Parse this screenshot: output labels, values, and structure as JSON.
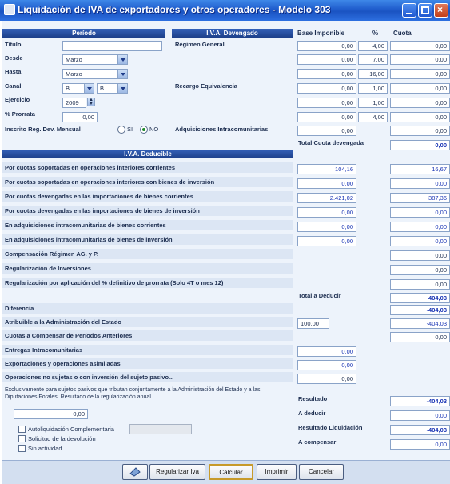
{
  "window": {
    "title": "Liquidación de IVA de exportadores y otros operadores - Modelo 303"
  },
  "periodo": {
    "header": "Período",
    "titulo_label": "Título",
    "titulo_value": "",
    "desde_label": "Desde",
    "desde_value": "Marzo",
    "hasta_label": "Hasta",
    "hasta_value": "Marzo",
    "canal_label": "Canal",
    "canal_value1": "B",
    "canal_value2": "B",
    "ejercicio_label": "Ejercicio",
    "ejercicio_value": "2009",
    "prorrata_label": "% Prorrata",
    "prorrata_value": "0,00",
    "inscrito_label": "Inscrito Reg. Dev. Mensual",
    "si_label": "SI",
    "no_label": "NO",
    "selected": "NO"
  },
  "devengado": {
    "header": "I.V.A. Devengado",
    "col_base": "Base Imponible",
    "col_pct": "%",
    "col_cuota": "Cuota",
    "regimen_general_label": "Régimen General",
    "recargo_label": "Recargo Equivalencia",
    "adquisiciones_label": "Adquisiciones Intracomunitarias",
    "total_label": "Total Cuota devengada",
    "rows": [
      {
        "base": "0,00",
        "pct": "4,00",
        "cuota": "0,00"
      },
      {
        "base": "0,00",
        "pct": "7,00",
        "cuota": "0,00"
      },
      {
        "base": "0,00",
        "pct": "16,00",
        "cuota": "0,00"
      },
      {
        "base": "0,00",
        "pct": "1,00",
        "cuota": "0,00"
      },
      {
        "base": "0,00",
        "pct": "1,00",
        "cuota": "0,00"
      },
      {
        "base": "0,00",
        "pct": "4,00",
        "cuota": "0,00"
      },
      {
        "base": "0,00",
        "pct": "",
        "cuota": "0,00"
      }
    ],
    "total_value": "0,00"
  },
  "deducible": {
    "header": "I.V.A. Deducible",
    "rows": [
      {
        "label": "Por cuotas soportadas en operaciones interiores corrientes",
        "base": "104,16",
        "cuota": "16,67"
      },
      {
        "label": "Por cuotas soportadas en operaciones interiores con bienes de inversión",
        "base": "0,00",
        "cuota": "0,00"
      },
      {
        "label": "Por cuotas devengadas en las importaciones de bienes corrientes",
        "base": "2.421,02",
        "cuota": "387,36"
      },
      {
        "label": "Por cuotas devengadas en las importaciones de bienes de inversión",
        "base": "0,00",
        "cuota": "0,00"
      },
      {
        "label": "En adquisiciones intracomunitarias de bienes corrientes",
        "base": "0,00",
        "cuota": "0,00"
      },
      {
        "label": "En adquisiciones intracomunitarias de bienes de inversión",
        "base": "0,00",
        "cuota": "0,00"
      },
      {
        "label": "Compensación Régimen AG. y P.",
        "base": "",
        "cuota": "0,00"
      },
      {
        "label": "Regularización de Inversiones",
        "base": "",
        "cuota": "0,00"
      },
      {
        "label": "Regularización por aplicación del % definitivo de prorrata (Solo 4T o mes 12)",
        "base": "",
        "cuota": "0,00"
      }
    ],
    "total_label": "Total a Deducir",
    "total_value": "404,03"
  },
  "resumen": {
    "diferencia_label": "Diferencia",
    "diferencia_value": "-404,03",
    "atribuible_label": "Atribuible a la Administración del Estado",
    "atribuible_pct": "100,00",
    "atribuible_value": "-404,03",
    "cuotas_label": "Cuotas a Compensar de Períodos Anteriores",
    "cuotas_value": "0,00",
    "entregas_label": "Entregas Intracomunitarias",
    "entregas_value": "0,00",
    "exportaciones_label": "Exportaciones y operaciones asimiladas",
    "exportaciones_value": "0,00",
    "no_sujetas_label": "Operaciones no sujetas o con inversión del sujeto pasivo...",
    "no_sujetas_value": "0,00",
    "nota": "Exclusivamente para sujetos pasivos que tributan conjuntamente a la Administración del Estado y a las Diputaciones Forales. Resultado de la regularización anual",
    "nota_value": "0,00",
    "resultado_label": "Resultado",
    "resultado_value": "-404,03",
    "a_deducir_label": "A deducir",
    "a_deducir_value": "0,00",
    "resultado_liq_label": "Resultado Liquidación",
    "resultado_liq_value": "-404,03",
    "a_compensar_label": "A compensar",
    "a_compensar_value": "0,00"
  },
  "opciones": {
    "autoliquidacion_label": "Autoliquidación Complementaria",
    "devolucion_label": "Solicitud de la devolución",
    "sin_actividad_label": "Sin actividad",
    "complementaria_value": ""
  },
  "buttons": {
    "regularizar": "Regularizar Iva",
    "calcular": "Calcular",
    "imprimir": "Imprimir",
    "cancelar": "Cancelar"
  }
}
